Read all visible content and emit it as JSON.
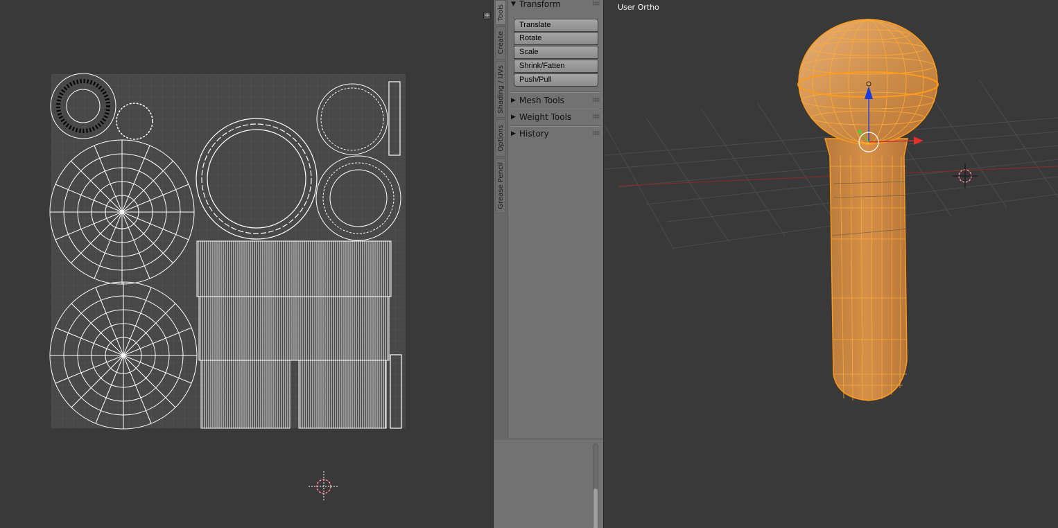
{
  "viewport": {
    "label": "User Ortho"
  },
  "tool_shelf": {
    "tabs": [
      {
        "label": "Tools",
        "active": true
      },
      {
        "label": "Create",
        "active": false
      },
      {
        "label": "Shading / UVs",
        "active": false
      },
      {
        "label": "Options",
        "active": false
      },
      {
        "label": "Grease Pencil",
        "active": false
      }
    ],
    "panels": {
      "transform": {
        "title": "Transform",
        "expanded": true,
        "buttons": [
          "Translate",
          "Rotate",
          "Scale",
          "Shrink/Fatten",
          "Push/Pull"
        ]
      },
      "mesh_tools": {
        "title": "Mesh Tools",
        "expanded": false
      },
      "weight_tools": {
        "title": "Weight Tools",
        "expanded": false
      },
      "history": {
        "title": "History",
        "expanded": false
      }
    }
  },
  "icons": {
    "expanded_arrow": "▼",
    "collapsed_arrow": "▶",
    "add_region": "+"
  },
  "colors": {
    "background": "#393939",
    "panel": "#727272",
    "selection_orange": "#ff9a1a",
    "x_axis": "#c8342c",
    "y_axis": "#5cc83a",
    "z_axis": "#1a3cdc"
  }
}
